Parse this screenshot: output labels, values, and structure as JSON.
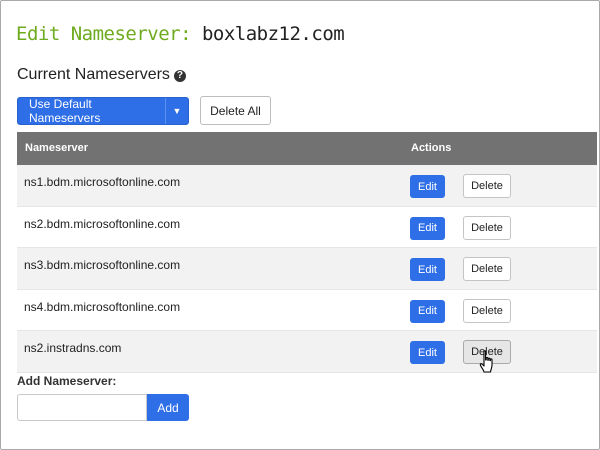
{
  "header": {
    "title_prefix": "Edit Nameserver:",
    "domain": "boxlabz12.com",
    "accent_color": "#6fab1f"
  },
  "section": {
    "title": "Current Nameservers",
    "help_icon": "?"
  },
  "toolbar": {
    "use_default_label": "Use Default Nameservers",
    "delete_all_label": "Delete All",
    "button_color": "#2e6ee6"
  },
  "table": {
    "columns": [
      "Nameserver",
      "Actions"
    ],
    "rows": [
      {
        "nameserver": "ns1.bdm.microsoftonline.com",
        "edit": "Edit",
        "delete": "Delete"
      },
      {
        "nameserver": "ns2.bdm.microsoftonline.com",
        "edit": "Edit",
        "delete": "Delete"
      },
      {
        "nameserver": "ns3.bdm.microsoftonline.com",
        "edit": "Edit",
        "delete": "Delete"
      },
      {
        "nameserver": "ns4.bdm.microsoftonline.com",
        "edit": "Edit",
        "delete": "Delete"
      },
      {
        "nameserver": "ns2.instradns.com",
        "edit": "Edit",
        "delete": "Delete"
      }
    ]
  },
  "add_form": {
    "label": "Add Nameserver:",
    "input_value": "",
    "input_placeholder": "",
    "add_label": "Add"
  }
}
